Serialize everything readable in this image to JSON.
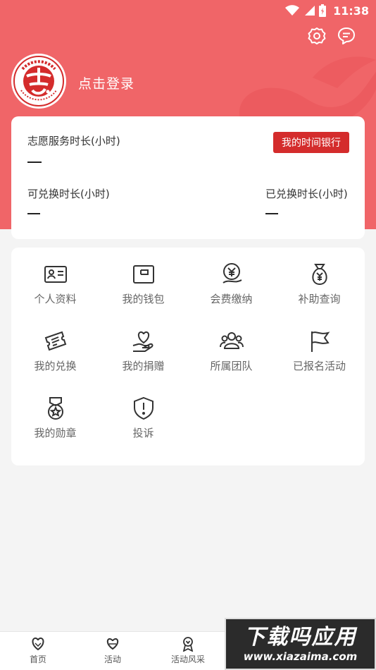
{
  "status_bar": {
    "time": "11:38",
    "icons": [
      "wifi-icon",
      "signal-icon",
      "battery-icon"
    ]
  },
  "header": {
    "login_text": "点击登录",
    "logo_name": "china-volunteer-service-logo",
    "actions": [
      "settings-icon",
      "message-icon"
    ]
  },
  "stats": {
    "service_hours_label": "志愿服务时长(小时)",
    "time_bank_button": "我的时间银行",
    "exchangeable_label": "可兑换时长(小时)",
    "exchanged_label": "已兑换时长(小时)"
  },
  "menu": [
    {
      "label": "个人资料",
      "icon": "id-card-icon"
    },
    {
      "label": "我的钱包",
      "icon": "wallet-icon"
    },
    {
      "label": "会费缴纳",
      "icon": "fee-payment-icon"
    },
    {
      "label": "补助查询",
      "icon": "money-bag-icon"
    },
    {
      "label": "我的兑换",
      "icon": "ticket-icon"
    },
    {
      "label": "我的捐赠",
      "icon": "donate-heart-icon"
    },
    {
      "label": "所属团队",
      "icon": "team-icon"
    },
    {
      "label": "已报名活动",
      "icon": "flag-icon"
    },
    {
      "label": "我的勋章",
      "icon": "medal-icon"
    },
    {
      "label": "投诉",
      "icon": "complaint-shield-icon"
    }
  ],
  "tabbar": [
    {
      "label": "首页",
      "icon": "home-heart-icon"
    },
    {
      "label": "活动",
      "icon": "activity-icon"
    },
    {
      "label": "活动风采",
      "icon": "award-icon"
    }
  ],
  "watermark": {
    "title": "下载吗应用",
    "url": "www.xiazaima.com"
  },
  "colors": {
    "brand_red": "#f06568",
    "button_red": "#d42c2c",
    "background": "#f4f4f4"
  }
}
